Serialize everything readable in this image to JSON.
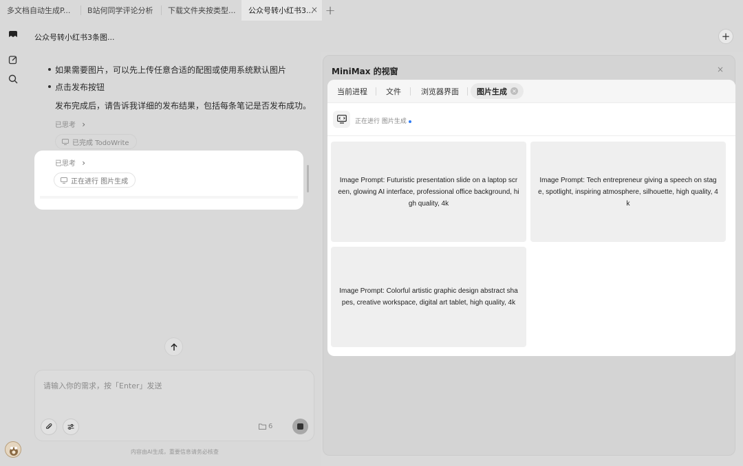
{
  "tabs": [
    {
      "label": "多文档自动生成P...",
      "active": false
    },
    {
      "label": "B站何同学评论分析",
      "active": false
    },
    {
      "label": "下载文件夹按类型...",
      "active": false
    },
    {
      "label": "公众号转小红书3...",
      "active": true
    }
  ],
  "tab_close": "×",
  "tab_new": "+",
  "header": {
    "title": "公众号转小红书3条图...",
    "new_label": "+"
  },
  "chat": {
    "bullets": [
      "如果需要图片，可以先上传任意合适的配图或使用系统默认图片",
      "点击发布按钮"
    ],
    "paragraph": "发布完成后，请告诉我详细的发布结果，包括每条笔记是否发布成功。",
    "thought_1": "已思考",
    "chip_done": "已完成 TodoWrite",
    "thought_2": "已思考",
    "chip_running": "正在进行 图片生成",
    "chevron": "›"
  },
  "composer": {
    "placeholder": "请输入你的需求，按「Enter」发送",
    "file_count": "6"
  },
  "disclaimer": "内容由AI生成，重要信息请务必核查",
  "panel": {
    "title": "MiniMax 的视窗",
    "close": "×",
    "tabs": [
      "当前进程",
      "文件",
      "浏览器界面",
      "图片生成"
    ],
    "active_tab_close": "×",
    "progress_label": "正在进行 图片生成",
    "images": [
      "Image Prompt: Futuristic presentation slide on a laptop screen, glowing AI interface, professional office background, high quality, 4k",
      "Image Prompt: Tech entrepreneur giving a speech on stage, spotlight, inspiring atmosphere, silhouette, high quality, 4k",
      "Image Prompt: Colorful artistic graphic design abstract shapes, creative workspace, digital art tablet, high quality, 4k"
    ]
  },
  "colors": {
    "accent_dot": "#2f7cf6",
    "dim_background": "#d9d9d9"
  }
}
